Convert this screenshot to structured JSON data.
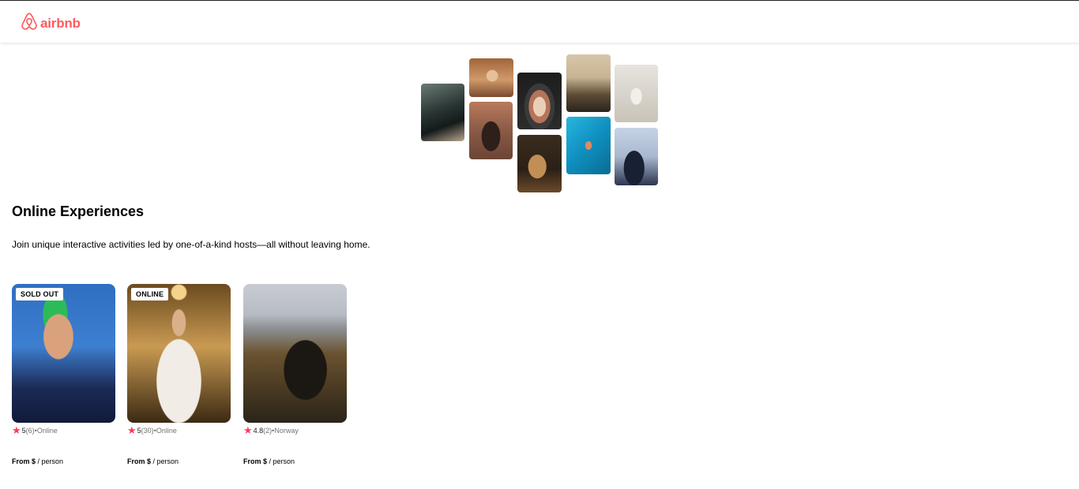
{
  "brand": {
    "name": "airbnb",
    "color": "#ff5a5f"
  },
  "hero": {
    "tiles": [
      {
        "name": "cooking-pots-photo",
        "colors": [
          "#4a5a55",
          "#1f2a2a",
          "#b8a58f"
        ]
      },
      {
        "name": "woman-portrait-photo",
        "colors": [
          "#d19a6a",
          "#7a4b2e",
          "#e5c09a"
        ]
      },
      {
        "name": "fireplace-dancer-photo",
        "colors": [
          "#8a5a46",
          "#2f1f1a",
          "#b97a5c"
        ]
      },
      {
        "name": "bowl-of-food-photo",
        "colors": [
          "#2c2c2c",
          "#b5735a",
          "#e8d0b6"
        ]
      },
      {
        "name": "guitar-player-photo",
        "colors": [
          "#2b2016",
          "#6b4a2a",
          "#c18e55"
        ]
      },
      {
        "name": "music-mixer-photo",
        "colors": [
          "#c8b493",
          "#5d4c36",
          "#2a241c"
        ]
      },
      {
        "name": "swimmer-pool-photo",
        "colors": [
          "#0f8fbf",
          "#28b6e0",
          "#0a6c92"
        ]
      },
      {
        "name": "yoga-woman-photo",
        "colors": [
          "#e7e4df",
          "#c9c3b8",
          "#f2efe9"
        ]
      },
      {
        "name": "singer-portrait-photo",
        "colors": [
          "#2d3550",
          "#c6d3e6",
          "#1a2033"
        ]
      }
    ]
  },
  "section": {
    "title": "Online Experiences",
    "subtitle": "Join unique interactive activities led by one-of-a-kind hosts—all without leaving home."
  },
  "cards": [
    {
      "badge": "SOLD OUT",
      "image": "swimmer-portrait",
      "rating": "5",
      "reviews": "(6)",
      "location": " •Online",
      "price_prefix": "From $",
      "price_suffix": " / person",
      "colors": [
        "#2f6fc1",
        "#1b2a55",
        "#d9a27c",
        "#2dbb5a"
      ]
    },
    {
      "badge": "ONLINE",
      "image": "bride-portrait",
      "rating": "5",
      "reviews": "(30)",
      "location": " •Online",
      "price_prefix": "From $",
      "price_suffix": " / person",
      "colors": [
        "#6b4a1f",
        "#3b2a13",
        "#f1ede6",
        "#c99a52"
      ]
    },
    {
      "badge": "",
      "image": "mountain-bike",
      "rating": "4.8",
      "reviews": "(2)",
      "location": " •Norway",
      "price_prefix": "From $",
      "price_suffix": " / person",
      "colors": [
        "#c8ccd2",
        "#6a5330",
        "#2a2419",
        "#8d8f93"
      ]
    }
  ]
}
